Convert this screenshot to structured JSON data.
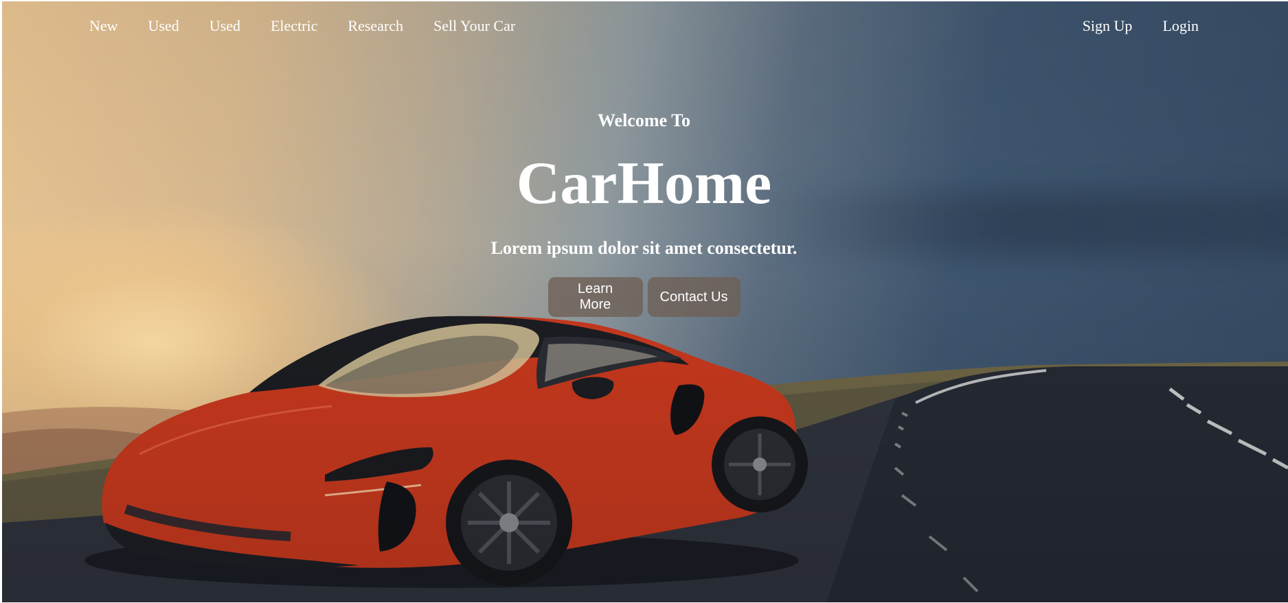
{
  "nav": {
    "left_items": [
      {
        "label": "New"
      },
      {
        "label": "Used"
      },
      {
        "label": "Used"
      },
      {
        "label": "Electric"
      },
      {
        "label": "Research"
      },
      {
        "label": "Sell Your Car"
      }
    ],
    "right_items": [
      {
        "label": "Sign Up"
      },
      {
        "label": "Login"
      }
    ]
  },
  "hero": {
    "welcome": "Welcome To",
    "brand": "CarHome",
    "tagline": "Lorem ipsum dolor sit amet consectetur.",
    "buttons": {
      "learn_more": "Learn More",
      "contact_us": "Contact Us"
    },
    "image": "hero-car-photo",
    "car_color": "#c8391e"
  },
  "colors": {
    "text": "#ffffff",
    "button_bg": "#6e5f55",
    "sky_warm": "#e7c391",
    "sky_cool": "#364b63",
    "road": "#2a2e38"
  }
}
